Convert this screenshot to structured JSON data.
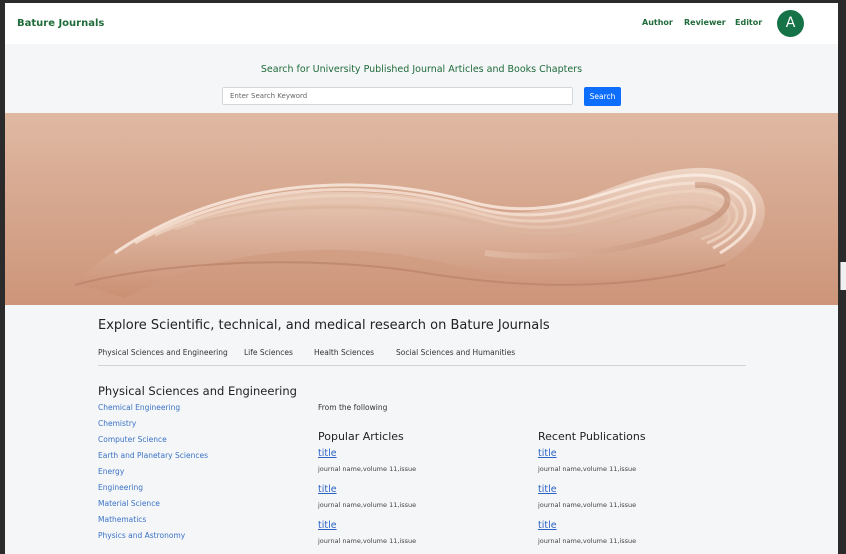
{
  "navbar": {
    "brand": "Bature Journals",
    "links": [
      "Author",
      "Reviewer",
      "Editor"
    ],
    "avatar_initial": "A"
  },
  "search": {
    "title": "Search for University Published Journal Articles and Books Chapters",
    "placeholder": "Enter Search Keyword",
    "button_label": "Search"
  },
  "explore": {
    "title": "Explore Scientific, technical, and medical research on Bature Journals",
    "tabs": [
      "Physical Sciences and Engineering",
      "Life Sciences",
      "Health Sciences",
      "Social Sciences and Humanities"
    ]
  },
  "section": {
    "title": "Physical Sciences and Engineering",
    "subjects": [
      "Chemical Engineering",
      "Chemistry",
      "Computer Science",
      "Earth and Planetary Sciences",
      "Energy",
      "Engineering",
      "Material Science",
      "Mathematics",
      "Physics and Astronomy"
    ],
    "from_text": "From the following",
    "popular": {
      "title": "Popular Articles",
      "items": [
        {
          "title": "title",
          "meta": "journal name,volume 11,issue"
        },
        {
          "title": "title",
          "meta": "journal name,volume 11,issue"
        },
        {
          "title": "title",
          "meta": "journal name,volume 11,issue"
        }
      ]
    },
    "recent": {
      "title": "Recent Publications",
      "items": [
        {
          "title": "title",
          "meta": "journal name,volume 11,issue"
        },
        {
          "title": "title",
          "meta": "journal name,volume 11,issue"
        },
        {
          "title": "title",
          "meta": "journal name,volume 11,issue"
        }
      ]
    }
  },
  "colors": {
    "brand_green": "#1f6b3a",
    "avatar_green": "#157347",
    "search_blue": "#0d6efd",
    "link_blue": "#3b73c5"
  }
}
